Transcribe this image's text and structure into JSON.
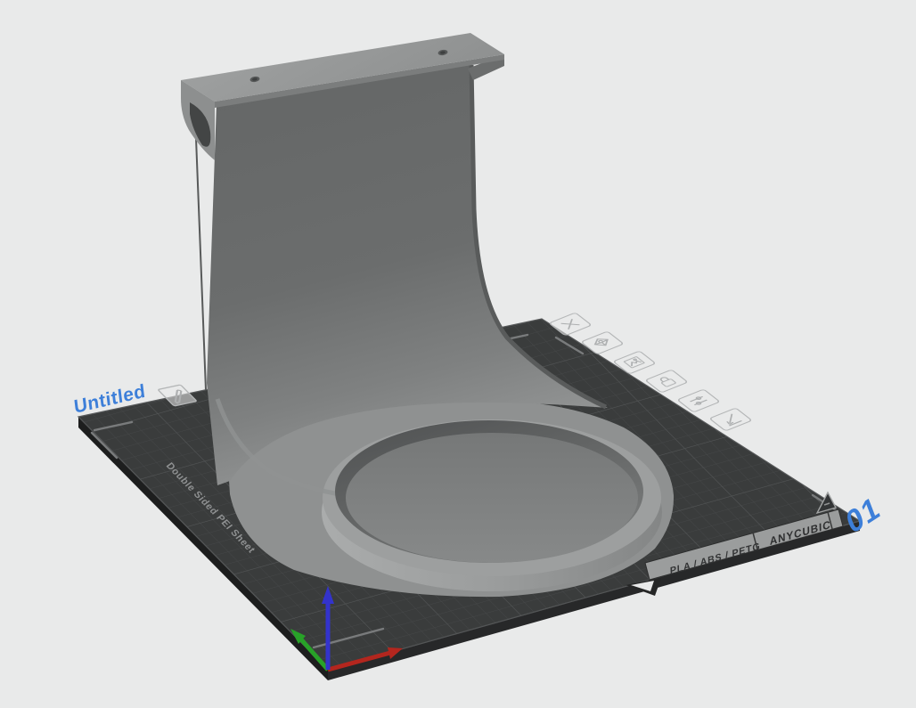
{
  "viewport": {
    "plate_name": "Untitled",
    "plate_number": "01",
    "sheet_type": "Double Sided PEI Sheet",
    "materials_label": "PLA / ABS / PETG",
    "brand": "ANYCUBIC"
  },
  "plate_toolbar": {
    "buttons": [
      {
        "icon": "delete-plate-icon"
      },
      {
        "icon": "orient-plate-icon"
      },
      {
        "icon": "plate-thumbnail-icon"
      },
      {
        "icon": "lock-plate-icon"
      },
      {
        "icon": "plate-settings-icon"
      },
      {
        "icon": "move-plate-front-icon"
      }
    ]
  },
  "icons": {
    "edit_plate_name": "pencil-icon",
    "corner_warning": "warning-triangle-icon"
  },
  "colors": {
    "background": "#e9eaea",
    "accent_blue": "#3d7fd9",
    "plate_surface": "#3a3c3c",
    "plate_grid": "#474949",
    "plate_band": "#9b9d9d",
    "model_gray": "#8b8d8d",
    "axis_x": "#b3261e",
    "axis_y": "#28a228",
    "axis_z": "#3333cc"
  }
}
